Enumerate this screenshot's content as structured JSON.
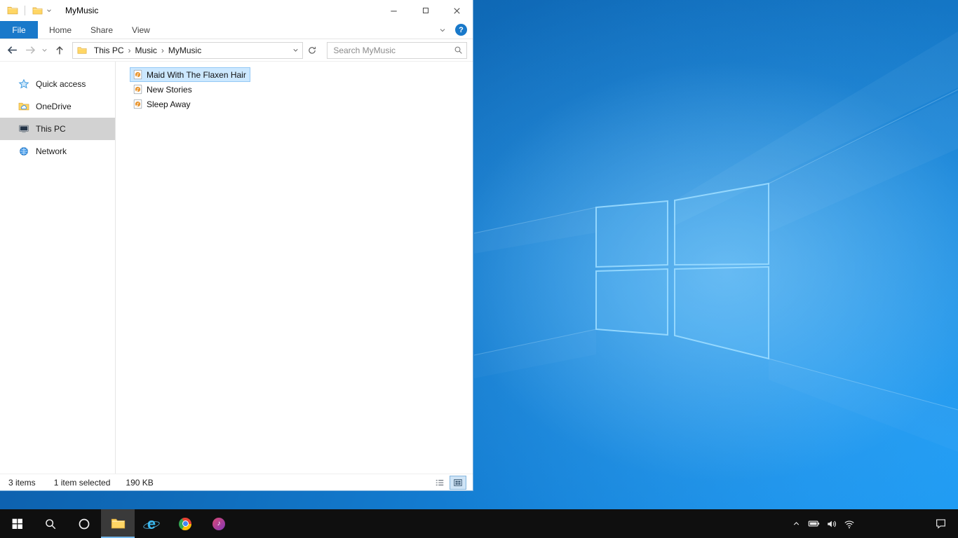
{
  "window": {
    "title": "MyMusic"
  },
  "ribbon": {
    "file_tab": "File",
    "tabs": [
      "Home",
      "Share",
      "View"
    ],
    "help_glyph": "?"
  },
  "navigation": {
    "breadcrumb": {
      "root": "This PC",
      "sep": "›",
      "folder": "Music",
      "current": "MyMusic"
    },
    "search_placeholder": "Search MyMusic"
  },
  "sidebar": {
    "items": [
      {
        "label": "Quick access",
        "icon": "quick-access-star-icon",
        "selected": false
      },
      {
        "label": "OneDrive",
        "icon": "onedrive-folder-icon",
        "selected": false
      },
      {
        "label": "This PC",
        "icon": "computer-icon",
        "selected": true
      },
      {
        "label": "Network",
        "icon": "network-globe-icon",
        "selected": false
      }
    ]
  },
  "files": [
    {
      "name": "Maid With The Flaxen Hair",
      "icon": "music-file-icon",
      "selected": true
    },
    {
      "name": "New Stories",
      "icon": "music-file-icon",
      "selected": false
    },
    {
      "name": "Sleep Away",
      "icon": "music-file-icon",
      "selected": false
    }
  ],
  "statusbar": {
    "count": "3 items",
    "selected": "1 item selected",
    "size": "190 KB"
  },
  "taskbar": {
    "items": [
      "start",
      "search",
      "cortana",
      "file-explorer",
      "internet-explorer",
      "chrome",
      "itunes"
    ],
    "active_item": "file-explorer",
    "ie_glyph": "e",
    "note_glyph": "♪",
    "tray": [
      "hidden-icons-chevron",
      "battery",
      "volume",
      "wifi",
      "action-center"
    ]
  },
  "colors": {
    "accent": "#1979ca",
    "selection_bg": "#cce8ff",
    "selection_border": "#94c8f5",
    "sidebar_selected": "#d2d2d2",
    "taskbar_bg": "#0f0f0f",
    "desktop_blue": "#1480d6"
  }
}
